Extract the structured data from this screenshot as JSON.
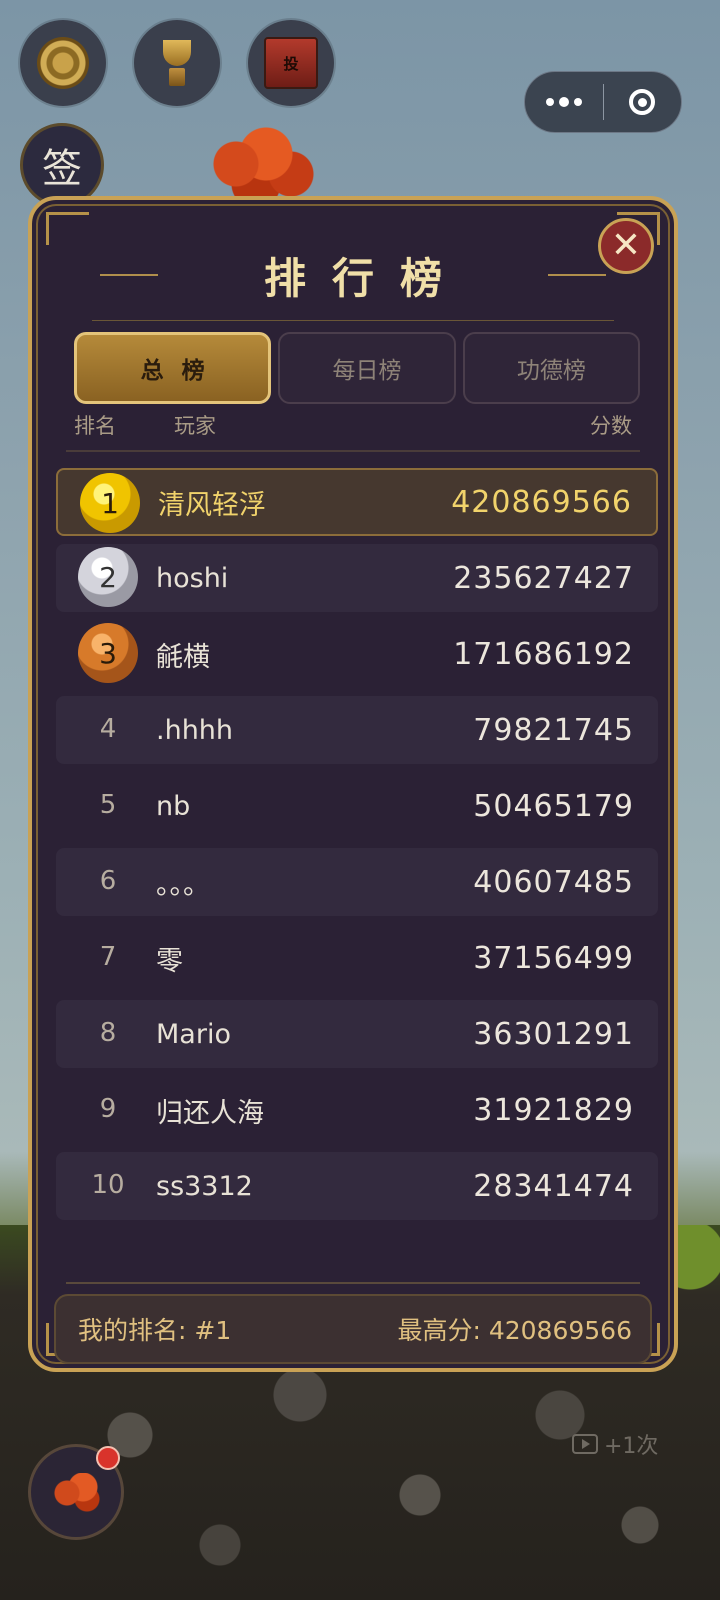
{
  "top_buttons": [
    {
      "name": "medal-icon"
    },
    {
      "name": "trophy-icon"
    },
    {
      "name": "donation-box-icon",
      "label": "投"
    }
  ],
  "sign_button": {
    "label": "签"
  },
  "capsule": {
    "more_icon": "more-dots-icon",
    "close_icon": "target-icon"
  },
  "leaderboard": {
    "title": "排行榜",
    "close_icon": "close-icon",
    "close_glyph": "✕",
    "tabs": [
      {
        "label": "总榜",
        "active": true
      },
      {
        "label": "每日榜",
        "active": false
      },
      {
        "label": "功德榜",
        "active": false
      }
    ],
    "columns": {
      "rank": "排名",
      "player": "玩家",
      "score": "分数"
    },
    "rows": [
      {
        "rank": "1",
        "name": "清风轻浮",
        "score": "420869566"
      },
      {
        "rank": "2",
        "name": "hoshi",
        "score": "235627427"
      },
      {
        "rank": "3",
        "name": "毹横",
        "score": "171686192"
      },
      {
        "rank": "4",
        "name": ".hhhh",
        "score": "79821745"
      },
      {
        "rank": "5",
        "name": "nb",
        "score": "50465179"
      },
      {
        "rank": "6",
        "name": "。。。",
        "score": "40607485"
      },
      {
        "rank": "7",
        "name": "零",
        "score": "37156499"
      },
      {
        "rank": "8",
        "name": "Mario",
        "score": "36301291"
      },
      {
        "rank": "9",
        "name": "归还人海",
        "score": "31921829"
      },
      {
        "rank": "10",
        "name": "ss3312",
        "score": "28341474"
      }
    ],
    "footer": {
      "my_rank": "我的排名: #1",
      "best_score": "最高分: 420869566"
    }
  },
  "bottom": {
    "ad_label": "+1次"
  },
  "colors": {
    "accent_gold": "#c9a255",
    "panel_bg": "#2b2135",
    "close_red": "#8b2a2a",
    "highlight_text": "#f1d36b"
  }
}
